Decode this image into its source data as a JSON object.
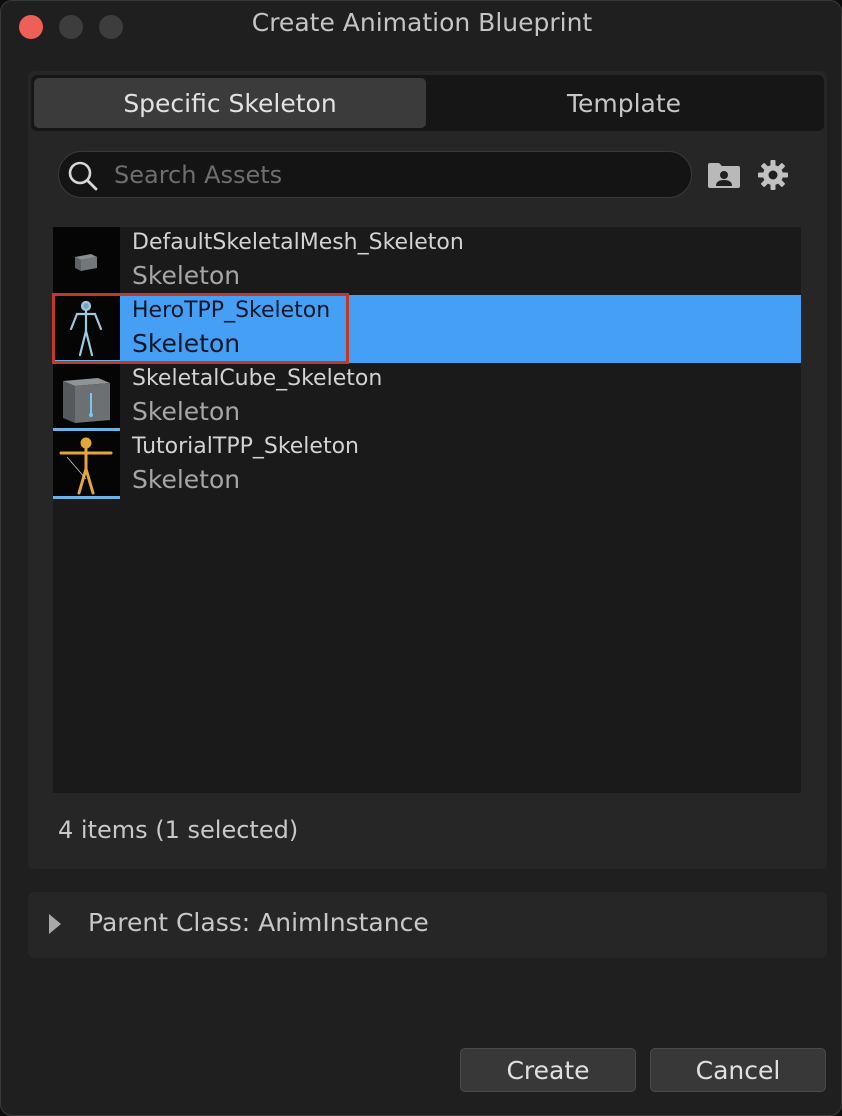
{
  "window": {
    "title": "Create Animation Blueprint"
  },
  "tabs": [
    {
      "label": "Specific Skeleton",
      "active": true
    },
    {
      "label": "Template",
      "active": false
    }
  ],
  "search": {
    "placeholder": "Search Assets",
    "value": ""
  },
  "toolbar": {
    "folder_icon": "folder-user-icon",
    "settings_icon": "gear-icon"
  },
  "assets": [
    {
      "name": "DefaultSkeletalMesh_Skeleton",
      "type": "Skeleton",
      "thumbnail": "mesh-thumbnail",
      "selected": false
    },
    {
      "name": "HeroTPP_Skeleton",
      "type": "Skeleton",
      "thumbnail": "hero-skeleton-thumbnail",
      "selected": true
    },
    {
      "name": "SkeletalCube_Skeleton",
      "type": "Skeleton",
      "thumbnail": "cube-thumbnail",
      "selected": false
    },
    {
      "name": "TutorialTPP_Skeleton",
      "type": "Skeleton",
      "thumbnail": "tutorial-mannequin-thumbnail",
      "selected": false
    }
  ],
  "status": {
    "count_text": "4 items (1 selected)"
  },
  "parent_class": {
    "label": "Parent Class: AnimInstance",
    "expanded": false
  },
  "buttons": {
    "create": "Create",
    "cancel": "Cancel"
  },
  "colors": {
    "selection": "#449ff5",
    "highlight_box": "#c0392b",
    "close_button": "#ee5f57"
  }
}
